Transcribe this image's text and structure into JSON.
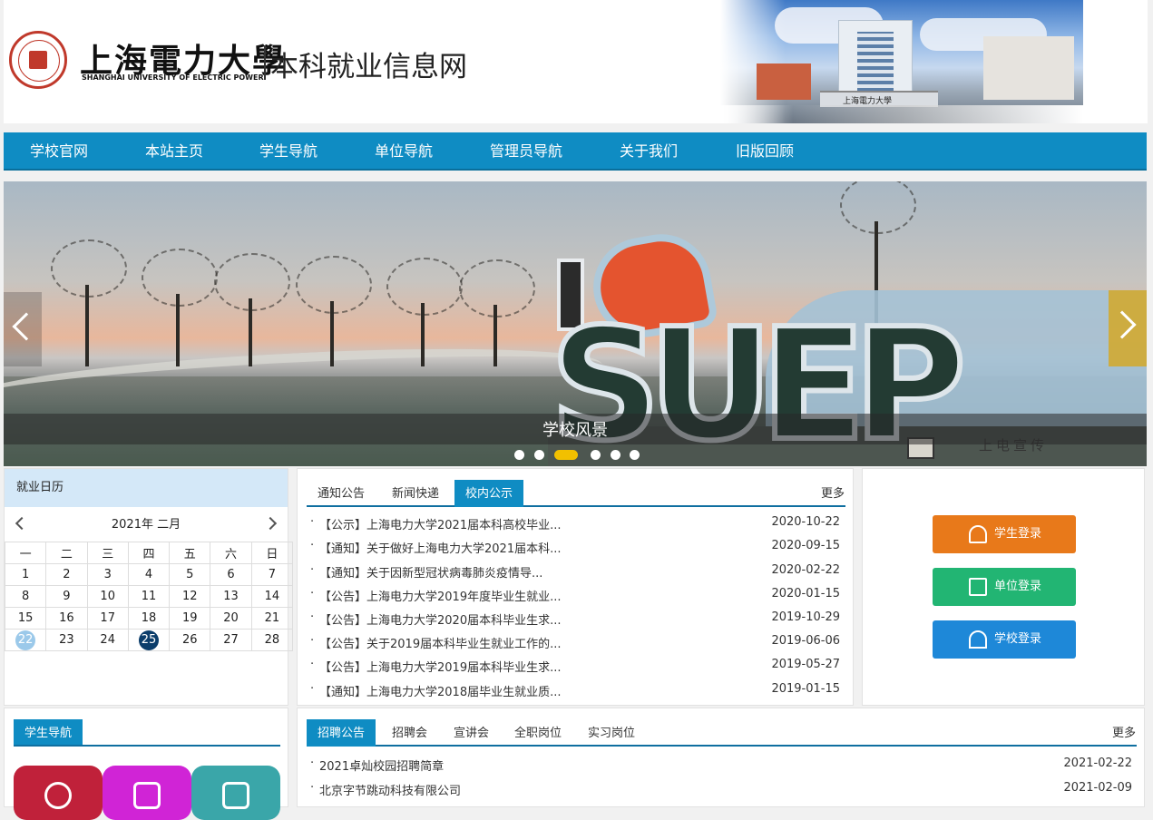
{
  "header": {
    "school_name_cn": "上海電力大學",
    "school_name_en": "SHANGHAI UNIVERSITY OF ELECTRIC POWER",
    "site_title": "本科就业信息网",
    "gate_sign": "上海電力大學"
  },
  "nav": {
    "items": [
      "学校官网",
      "本站主页",
      "学生导航",
      "单位导航",
      "管理员导航",
      "关于我们",
      "旧版回顾"
    ]
  },
  "banner": {
    "caption": "学校风景",
    "sculpture_text": "SUEP",
    "watermark": "上电宣传",
    "slide_count": 6,
    "active_slide": 3
  },
  "calendar": {
    "title": "就业日历",
    "month_label": "2021年 二月",
    "weekdays": [
      "一",
      "二",
      "三",
      "四",
      "五",
      "六",
      "日"
    ],
    "weeks": [
      [
        "1",
        "2",
        "3",
        "4",
        "5",
        "6",
        "7"
      ],
      [
        "8",
        "9",
        "10",
        "11",
        "12",
        "13",
        "14"
      ],
      [
        "15",
        "16",
        "17",
        "18",
        "19",
        "20",
        "21"
      ],
      [
        "22",
        "23",
        "24",
        "25",
        "26",
        "27",
        "28"
      ]
    ],
    "today": "22",
    "selected": "25"
  },
  "news": {
    "tabs": [
      "通知公告",
      "新闻快递",
      "校内公示"
    ],
    "active_tab": 2,
    "more": "更多",
    "items": [
      {
        "title": "【公示】上海电力大学2021届本科高校毕业...",
        "date": "2020-10-22"
      },
      {
        "title": "【通知】关于做好上海电力大学2021届本科...",
        "date": "2020-09-15"
      },
      {
        "title": "【通知】关于因新型冠状病毒肺炎疫情导...",
        "date": "2020-02-22"
      },
      {
        "title": "【公告】上海电力大学2019年度毕业生就业...",
        "date": "2020-01-15"
      },
      {
        "title": "【公告】上海电力大学2020届本科毕业生求...",
        "date": "2019-10-29"
      },
      {
        "title": "【公告】关于2019届本科毕业生就业工作的...",
        "date": "2019-06-06"
      },
      {
        "title": "【公告】上海电力大学2019届本科毕业生求...",
        "date": "2019-05-27"
      },
      {
        "title": "【通知】上海电力大学2018届毕业生就业质...",
        "date": "2019-01-15"
      }
    ]
  },
  "login": {
    "student": "学生登录",
    "unit": "单位登录",
    "school": "学校登录",
    "colors": {
      "student": "#e8791a",
      "unit": "#22b573",
      "school": "#1e88d8"
    }
  },
  "student_guide": {
    "tab": "学生导航",
    "tile_colors": [
      "#c0213a",
      "#d024d6",
      "#3aa6a9"
    ]
  },
  "jobs": {
    "tabs": [
      "招聘公告",
      "招聘会",
      "宣讲会",
      "全职岗位",
      "实习岗位"
    ],
    "active_tab": 0,
    "more": "更多",
    "items": [
      {
        "title": "2021卓灿校园招聘简章",
        "date": "2021-02-22"
      },
      {
        "title": "北京字节跳动科技有限公司",
        "date": "2021-02-09"
      }
    ]
  },
  "colors": {
    "nav": "#0f8cc3",
    "calendar_header": "#d4e8f8",
    "slide_active_dot": "#f2c000",
    "next_arrow": "#d4a828"
  }
}
